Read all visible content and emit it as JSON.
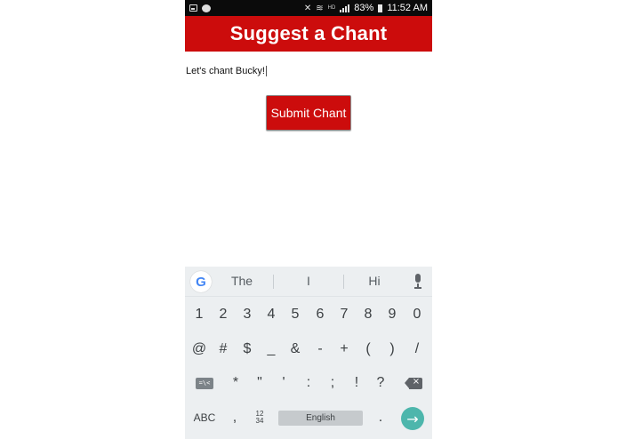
{
  "status_bar": {
    "battery": "83%",
    "time": "11:52 AM",
    "network_tag": "HD"
  },
  "header": {
    "title": "Suggest a Chant"
  },
  "chant_input": {
    "value": "Let's chant Bucky!"
  },
  "submit_button": {
    "label": "Submit Chant"
  },
  "keyboard": {
    "suggestions": [
      "The",
      "I",
      "Hi"
    ],
    "row1": [
      "1",
      "2",
      "3",
      "4",
      "5",
      "6",
      "7",
      "8",
      "9",
      "0"
    ],
    "row2": [
      "@",
      "#",
      "$",
      "_",
      "&",
      "-",
      "+",
      "(",
      ")",
      "/"
    ],
    "row3": {
      "tab_symbol": "=\\<",
      "keys": [
        "*",
        "\"",
        "'",
        ":",
        ";",
        "!",
        "?"
      ]
    },
    "row4": {
      "abc_label": "ABC",
      "comma": ",",
      "numpad_top": "12",
      "numpad_bottom": "34",
      "space_label": "English",
      "period": ".",
      "enter_symbol": "→"
    }
  },
  "colors": {
    "brand_red": "#cc0c0c",
    "status_bar": "#0b0b0b",
    "keyboard_bg": "#eceff1",
    "enter_key": "#4db6ac"
  }
}
